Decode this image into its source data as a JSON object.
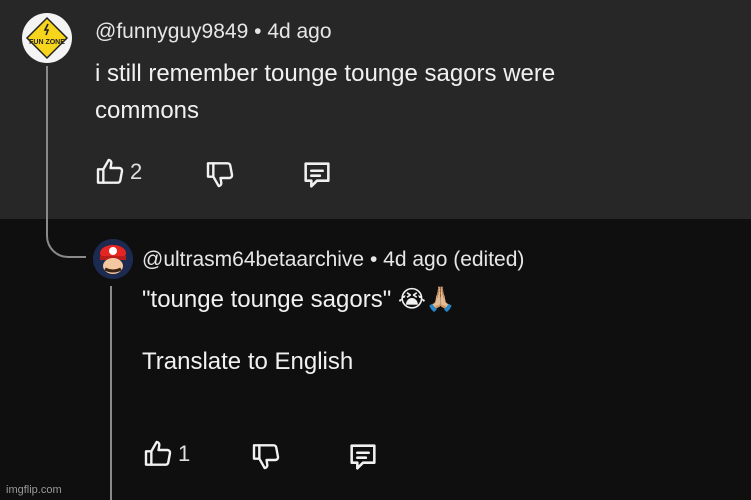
{
  "comment": {
    "handle": "@funnyguy9849",
    "separator": "•",
    "time": "4d ago",
    "text": "i still remember tounge tounge sagors were commons",
    "likes": "2",
    "avatar_icon": "fun-zone-logo-icon",
    "avatar_logo_text": "FUN ZONE"
  },
  "reply": {
    "handle": "@ultrasm64betaarchive",
    "separator": "•",
    "time": "4d ago (edited)",
    "text": "\"tounge tounge sagors\" 😭🙏🏼",
    "translate_label": "Translate to English",
    "likes": "1",
    "avatar_icon": "mario-avatar-icon"
  },
  "icons": {
    "like": "thumbs-up-icon",
    "dislike": "thumbs-down-icon",
    "reply": "reply-comment-icon"
  },
  "watermark": "imgflip.com",
  "colors": {
    "top_background": "#272727",
    "bottom_background": "#0f0f0f",
    "text": "#f1f1f1",
    "thread_line": "#8a8a8a"
  }
}
